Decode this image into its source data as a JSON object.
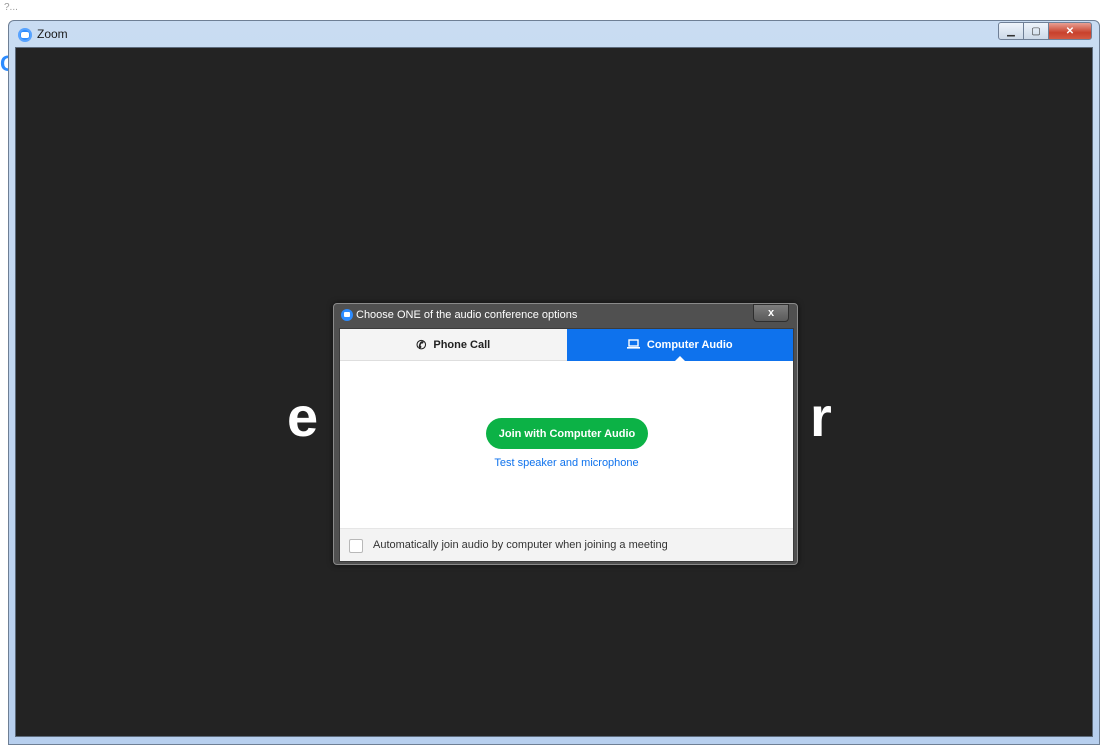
{
  "background": {
    "partial_text": "?...",
    "partial_icon": "zoom-logo-partial"
  },
  "window": {
    "title": "Zoom",
    "icon": "zoom-icon",
    "controls": {
      "minimize": "▁",
      "maximize": "▢",
      "close": "✕"
    }
  },
  "backdrop": {
    "left_letter": "e",
    "right_letter": "r"
  },
  "dialog": {
    "title": "Choose ONE of the audio conference options",
    "close_label": "x",
    "tabs": [
      {
        "label": "Phone Call",
        "icon": "phone-icon",
        "selected": false
      },
      {
        "label": "Computer Audio",
        "icon": "laptop-icon",
        "selected": true
      }
    ],
    "join_button": "Join with Computer Audio",
    "test_link": "Test speaker and microphone",
    "auto_join_label": "Automatically join audio by computer when joining a meeting",
    "auto_join_checked": false
  },
  "colors": {
    "accent": "#0e72ed",
    "join_green": "#0cb246",
    "backdrop": "#232323"
  }
}
